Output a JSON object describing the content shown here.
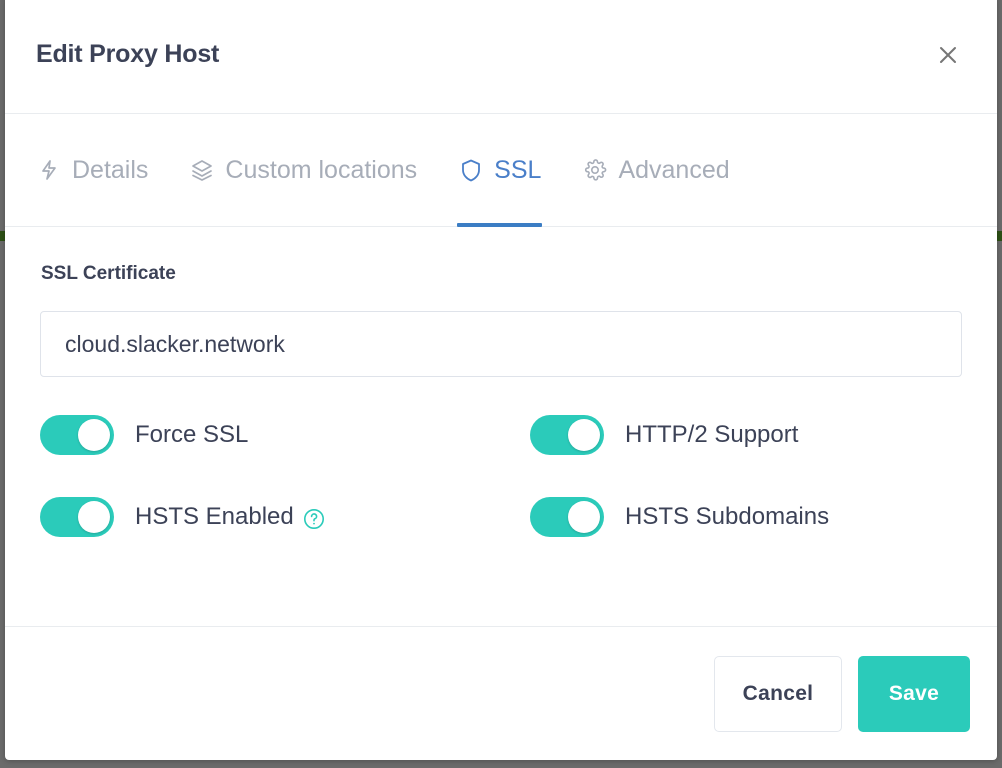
{
  "modal": {
    "title": "Edit Proxy Host",
    "close_icon": "close-icon"
  },
  "tabs": [
    {
      "label": "Details",
      "icon": "lightning-bolt-icon",
      "active": false
    },
    {
      "label": "Custom locations",
      "icon": "layers-icon",
      "active": false
    },
    {
      "label": "SSL",
      "icon": "shield-icon",
      "active": true
    },
    {
      "label": "Advanced",
      "icon": "gear-icon",
      "active": false
    }
  ],
  "ssl": {
    "certificate_label": "SSL Certificate",
    "certificate_value": "cloud.slacker.network",
    "certificate_placeholder": "cloud.slacker.network",
    "toggles": [
      {
        "label": "Force SSL",
        "on": true,
        "help": false
      },
      {
        "label": "HTTP/2 Support",
        "on": true,
        "help": false
      },
      {
        "label": "HSTS Enabled",
        "on": true,
        "help": true,
        "help_icon": "help-circle-icon"
      },
      {
        "label": "HSTS Subdomains",
        "on": true,
        "help": false
      }
    ]
  },
  "footer": {
    "cancel_label": "Cancel",
    "save_label": "Save"
  },
  "colors": {
    "accent_teal": "#2bcbba",
    "accent_blue": "#3b7dc4",
    "text_dark": "#3c4257",
    "text_muted": "#a7adb8",
    "border": "#e9ecef"
  }
}
